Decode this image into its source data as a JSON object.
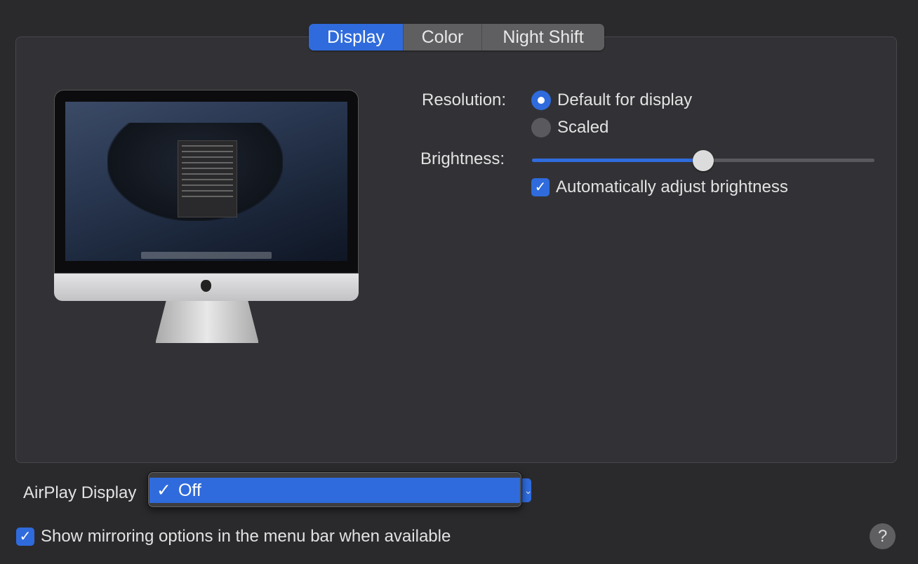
{
  "tabs": [
    {
      "label": "Display",
      "active": true
    },
    {
      "label": "Color",
      "active": false
    },
    {
      "label": "Night Shift",
      "active": false
    }
  ],
  "display": {
    "resolution_label": "Resolution:",
    "resolution_options": [
      {
        "label": "Default for display",
        "selected": true
      },
      {
        "label": "Scaled",
        "selected": false
      }
    ],
    "brightness_label": "Brightness:",
    "brightness_percent": 50,
    "auto_brightness_label": "Automatically adjust brightness",
    "auto_brightness_checked": true
  },
  "airplay": {
    "label": "AirPlay Display",
    "menu_item": "Off",
    "checkmark": "✓"
  },
  "mirroring": {
    "label": "Show mirroring options in the menu bar when available",
    "checked": true
  },
  "help_label": "?",
  "colors": {
    "accent": "#2f6bdc",
    "background": "#2a2a2d",
    "panel": "#323236"
  }
}
